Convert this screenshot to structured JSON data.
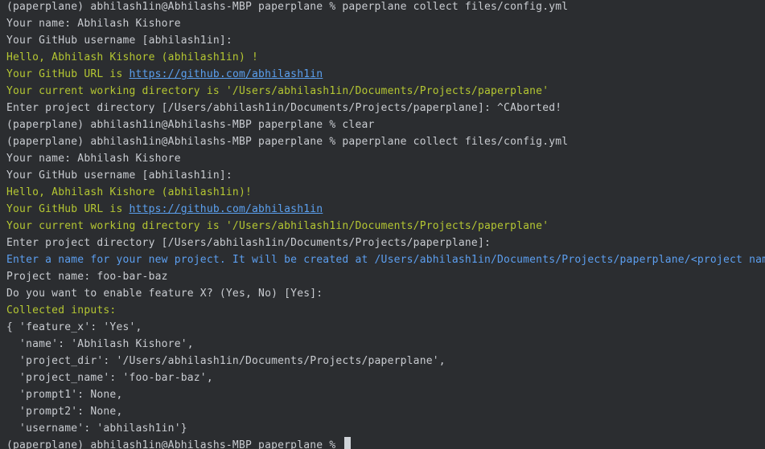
{
  "colors": {
    "background": "#2b2d30",
    "default": "#c9ccd1",
    "green": "#b4c632",
    "blue": "#5c9ff0",
    "link": "#5ba0ef",
    "cursor": "#cfd3d8"
  },
  "terminal": {
    "lines": [
      {
        "segments": [
          {
            "text": "(paperplane) abhilash1in@Abhilashs-MBP paperplane % paperplane collect files/config.yml",
            "color": "default"
          }
        ]
      },
      {
        "segments": [
          {
            "text": "Your name: Abhilash Kishore",
            "color": "default"
          }
        ]
      },
      {
        "segments": [
          {
            "text": "Your GitHub username [abhilash1in]:",
            "color": "default"
          }
        ]
      },
      {
        "segments": [
          {
            "text": "Hello, Abhilash Kishore (abhilash1in) !",
            "color": "green"
          }
        ]
      },
      {
        "segments": [
          {
            "text": "Your GitHub URL is ",
            "color": "green"
          },
          {
            "text": "https://github.com/abhilash1in",
            "color": "link",
            "link": true
          }
        ]
      },
      {
        "segments": [
          {
            "text": "Your current working directory is '/Users/abhilash1in/Documents/Projects/paperplane'",
            "color": "green"
          }
        ]
      },
      {
        "segments": [
          {
            "text": "Enter project directory [/Users/abhilash1in/Documents/Projects/paperplane]: ^CAborted!",
            "color": "default"
          }
        ]
      },
      {
        "segments": [
          {
            "text": "(paperplane) abhilash1in@Abhilashs-MBP paperplane % clear",
            "color": "default"
          }
        ]
      },
      {
        "segments": [
          {
            "text": "(paperplane) abhilash1in@Abhilashs-MBP paperplane % paperplane collect files/config.yml",
            "color": "default"
          }
        ]
      },
      {
        "segments": [
          {
            "text": "Your name: Abhilash Kishore",
            "color": "default"
          }
        ]
      },
      {
        "segments": [
          {
            "text": "Your GitHub username [abhilash1in]:",
            "color": "default"
          }
        ]
      },
      {
        "segments": [
          {
            "text": "Hello, Abhilash Kishore (abhilash1in)!",
            "color": "green"
          }
        ]
      },
      {
        "segments": [
          {
            "text": "Your GitHub URL is ",
            "color": "green"
          },
          {
            "text": "https://github.com/abhilash1in",
            "color": "link",
            "link": true
          }
        ]
      },
      {
        "segments": [
          {
            "text": "Your current working directory is '/Users/abhilash1in/Documents/Projects/paperplane'",
            "color": "green"
          }
        ]
      },
      {
        "segments": [
          {
            "text": "Enter project directory [/Users/abhilash1in/Documents/Projects/paperplane]:",
            "color": "default"
          }
        ]
      },
      {
        "segments": [
          {
            "text": "Enter a name for your new project. It will be created at /Users/abhilash1in/Documents/Projects/paperplane/<project nam",
            "color": "blue"
          }
        ]
      },
      {
        "segments": [
          {
            "text": "Project name: foo-bar-baz",
            "color": "default"
          }
        ]
      },
      {
        "segments": [
          {
            "text": "Do you want to enable feature X? (Yes, No) [Yes]:",
            "color": "default"
          }
        ]
      },
      {
        "segments": [
          {
            "text": "Collected inputs:",
            "color": "green"
          }
        ]
      },
      {
        "segments": [
          {
            "text": "{ 'feature_x': 'Yes',",
            "color": "default"
          }
        ]
      },
      {
        "segments": [
          {
            "text": "  'name': 'Abhilash Kishore',",
            "color": "default"
          }
        ]
      },
      {
        "segments": [
          {
            "text": "  'project_dir': '/Users/abhilash1in/Documents/Projects/paperplane',",
            "color": "default"
          }
        ]
      },
      {
        "segments": [
          {
            "text": "  'project_name': 'foo-bar-baz',",
            "color": "default"
          }
        ]
      },
      {
        "segments": [
          {
            "text": "  'prompt1': None,",
            "color": "default"
          }
        ]
      },
      {
        "segments": [
          {
            "text": "  'prompt2': None,",
            "color": "default"
          }
        ]
      },
      {
        "segments": [
          {
            "text": "  'username': 'abhilash1in'}",
            "color": "default"
          }
        ]
      },
      {
        "segments": [
          {
            "text": "(paperplane) abhilash1in@Abhilashs-MBP paperplane % ",
            "color": "default"
          }
        ],
        "cursor": true
      }
    ]
  }
}
